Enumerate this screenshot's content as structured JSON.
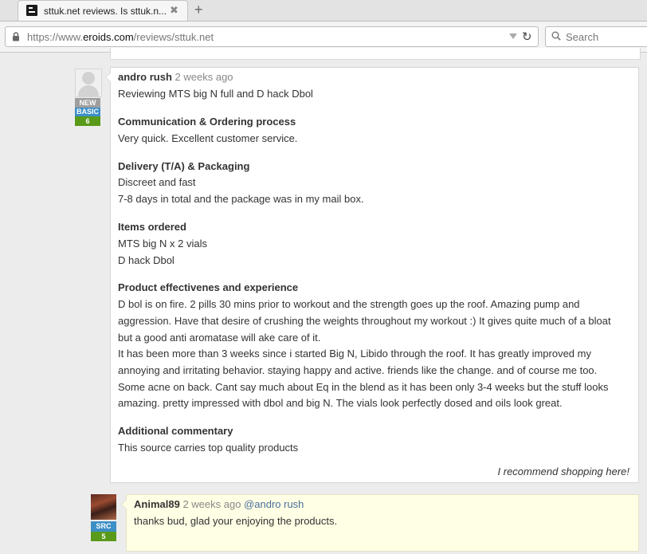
{
  "browser": {
    "tab_title": "sttuk.net reviews. Is sttuk.n...",
    "tab_close": "✖",
    "new_tab": "+",
    "url_prefix": "https://www.",
    "url_domain": "eroids.com",
    "url_path": "/reviews/sttuk.net",
    "search_placeholder": "Search"
  },
  "review": {
    "author": "andro rush",
    "time": "2 weeks ago",
    "badge_new": "NEW",
    "badge_basic": "BASIC",
    "badge_count": "6",
    "summary": "Reviewing MTS big N full and D hack Dbol",
    "sections": [
      {
        "heading": "Communication & Ordering process",
        "lines": [
          "Very quick. Excellent customer service."
        ]
      },
      {
        "heading": "Delivery (T/A) & Packaging",
        "lines": [
          "Discreet and fast",
          "7-8 days in total and the package was in my mail box."
        ]
      },
      {
        "heading": "Items ordered",
        "lines": [
          "MTS big N x 2 vials",
          "D hack Dbol"
        ]
      },
      {
        "heading": "Product effectivenes and experience",
        "lines": [
          "D bol is on fire. 2 pills 30 mins prior to workout and the strength goes up the roof. Amazing pump and",
          "aggression. Have that desire of crushing the weights throughout my workout :) It gives quite much of a bloat",
          "but a good anti aromatase will ake care of it.",
          "It has been more than 3 weeks since i started Big N, Libido through the roof. It has greatly improved my",
          "annoying and irritating behavior. staying happy and active. friends like the change. and of course me too.",
          "Some acne on back. Cant say much about Eq in the blend as it has been only 3-4 weeks but the stuff looks",
          "amazing. pretty impressed with dbol and big N. The vials look perfectly dosed and oils look great."
        ]
      },
      {
        "heading": "Additional commentary",
        "lines": [
          "This source carries top quality products"
        ]
      }
    ],
    "recommendation": "I recommend shopping here!"
  },
  "reply": {
    "author": "Animal89",
    "time": "2 weeks ago",
    "mention": "@andro rush",
    "badge_src": "SRC",
    "badge_count": "5",
    "text": "thanks bud, glad your enjoying the products."
  }
}
